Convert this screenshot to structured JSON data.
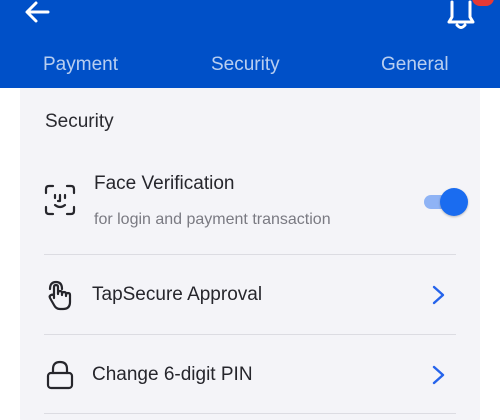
{
  "header": {
    "background_color": "#0050c8",
    "back_icon": "arrow-left-icon",
    "notification_icon": "bell-icon",
    "badge_color": "#e53935"
  },
  "tabs": [
    {
      "label": "Payment",
      "active": false
    },
    {
      "label": "Security",
      "active": true
    },
    {
      "label": "General",
      "active": false
    }
  ],
  "section": {
    "title": "Security"
  },
  "rows": [
    {
      "icon": "face-scan-icon",
      "title": "Face Verification",
      "subtitle": "for login and payment transaction",
      "control": "toggle",
      "toggle_on": true,
      "toggle_color": "#1a6cf0"
    },
    {
      "icon": "tap-hand-icon",
      "title": "TapSecure Approval",
      "control": "chevron-right-icon"
    },
    {
      "icon": "lock-icon",
      "title": "Change 6-digit PIN",
      "control": "chevron-right-icon"
    }
  ],
  "accent_color": "#2563eb"
}
